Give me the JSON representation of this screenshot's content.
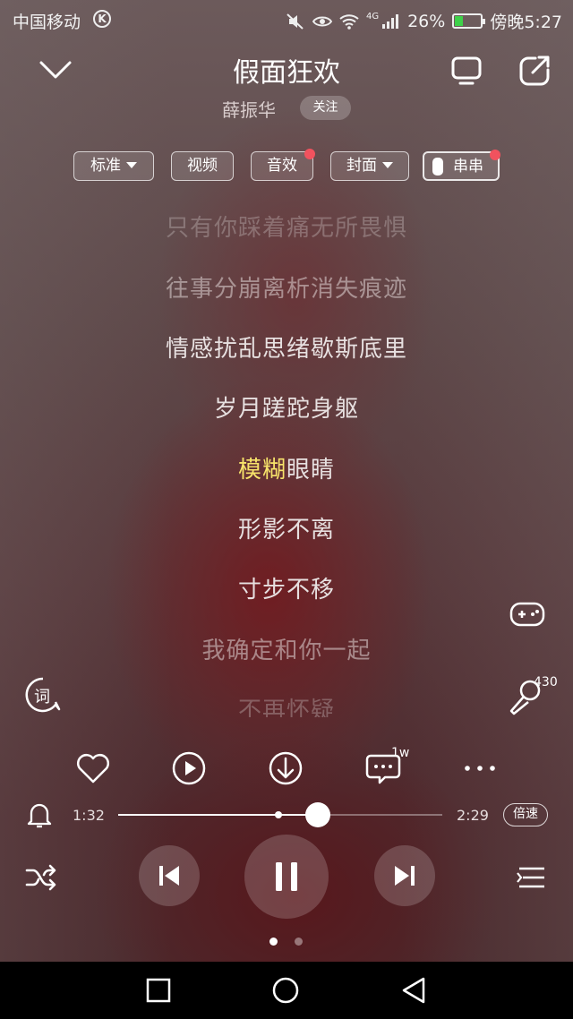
{
  "status_bar": {
    "carrier": "中国移动",
    "carrier_badge": "K",
    "network": "4G",
    "battery": "26%",
    "time": "傍晚5:27"
  },
  "song": {
    "title": "假面狂欢",
    "artist": "薛振华",
    "follow_label": "关注"
  },
  "chips": [
    {
      "label": "标准",
      "dropdown": true,
      "red_dot": false
    },
    {
      "label": "视频",
      "dropdown": false,
      "red_dot": false
    },
    {
      "label": "音效",
      "dropdown": false,
      "red_dot": true
    },
    {
      "label": "封面",
      "dropdown": true,
      "red_dot": false
    },
    {
      "label": "串串",
      "toggle": true,
      "red_dot": true
    }
  ],
  "lyrics": [
    {
      "text": "只有你踩着痛无所畏惧",
      "state": "faint"
    },
    {
      "text": "往事分崩离析消失痕迹",
      "state": "dim"
    },
    {
      "text": "情感扰乱思绪歇斯底里",
      "state": "normal"
    },
    {
      "text": "岁月蹉跎身躯",
      "state": "normal"
    },
    {
      "text_sung": "模糊",
      "text_rest": "眼睛",
      "state": "active"
    },
    {
      "text": "形影不离",
      "state": "normal"
    },
    {
      "text": "寸步不移",
      "state": "normal"
    },
    {
      "text": "我确定和你一起",
      "state": "dim"
    },
    {
      "text": "不再怀疑",
      "state": "faint"
    }
  ],
  "side": {
    "lyrics_icon_label": "词",
    "karaoke_count": "430"
  },
  "actions": {
    "comment_count": "1w"
  },
  "player": {
    "elapsed": "1:32",
    "duration": "2:29",
    "progress": 0.6174,
    "speed_label": "倍速",
    "page_count": 2,
    "page_active": 1
  },
  "colors": {
    "lyric_highlight": "#f7e36a",
    "red_dot": "#f1525e",
    "battery_fill": "#3fd14a"
  }
}
